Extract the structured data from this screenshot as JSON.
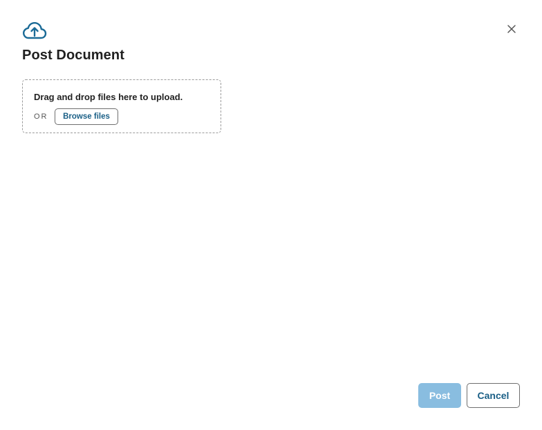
{
  "dialog": {
    "title": "Post Document",
    "header_icon": "cloud-upload-icon",
    "close_icon": "close-icon",
    "accent_color": "#1a6a96"
  },
  "dropzone": {
    "instruction": "Drag and drop files here to upload.",
    "or_label": "OR",
    "browse_label": "Browse files"
  },
  "footer": {
    "post_label": "Post",
    "post_state": "disabled",
    "post_color": "#89bde0",
    "cancel_label": "Cancel"
  }
}
